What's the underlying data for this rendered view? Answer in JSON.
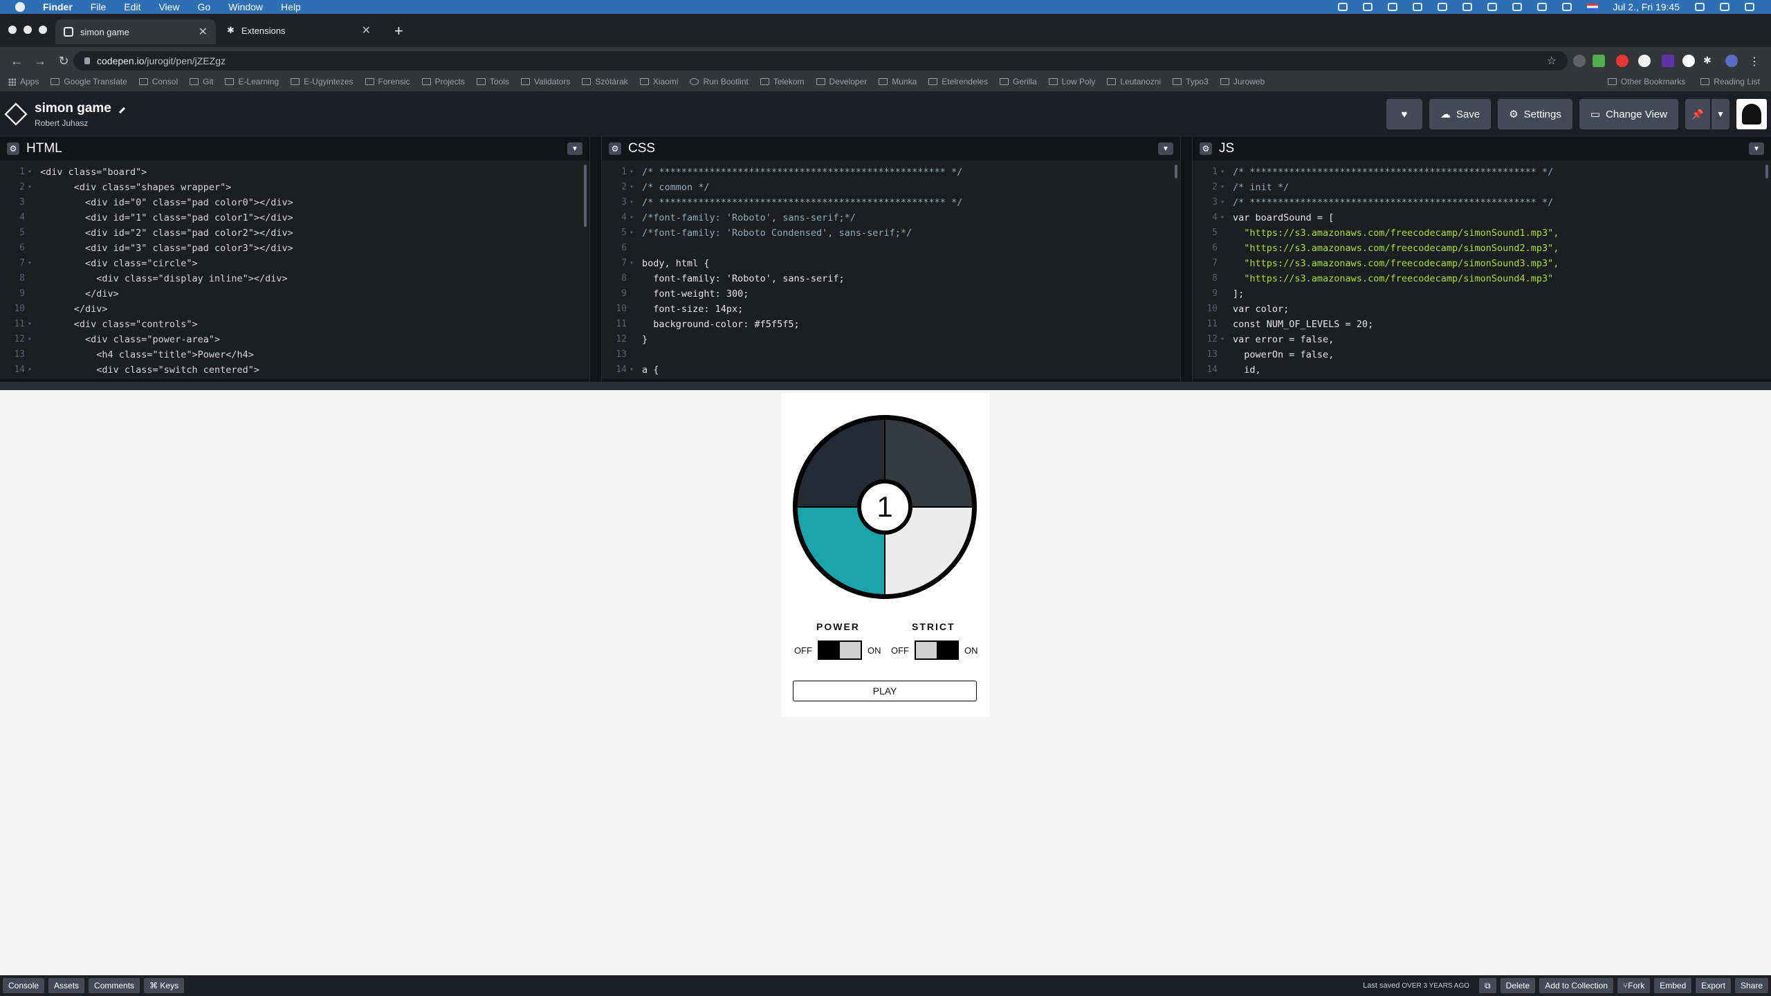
{
  "menubar": {
    "app_name": "Finder",
    "menus": [
      "File",
      "Edit",
      "View",
      "Go",
      "Window",
      "Help"
    ],
    "clock": "Jul 2., Fri 19:45"
  },
  "browser": {
    "tabs": [
      {
        "title": "simon game",
        "active": true
      },
      {
        "title": "Extensions",
        "active": false
      }
    ],
    "url_host": "codepen.io",
    "url_path": "/jurogit/pen/jZEZgz",
    "bookmarks": [
      "Apps",
      "Google Translate",
      "Consol",
      "Git",
      "E-Learning",
      "E-Ugyintezes",
      "Forensic",
      "Projects",
      "Tools",
      "Validators",
      "Szótárak",
      "Xiaomi",
      "Run Bootlint",
      "Telekom",
      "Developer",
      "Munka",
      "Etelrendeles",
      "Gerilla",
      "Low Poly",
      "Leutanozni",
      "Typo3",
      "Juroweb"
    ],
    "other_bookmarks": "Other Bookmarks",
    "reading_list": "Reading List"
  },
  "codepen": {
    "title": "simon game",
    "author": "Robert Juhasz",
    "buttons": {
      "save": "Save",
      "settings": "Settings",
      "change_view": "Change View"
    }
  },
  "editors": {
    "html": {
      "name": "HTML",
      "lines": [
        {
          "n": "1",
          "f": "▾",
          "t": "<div class=\"board\">"
        },
        {
          "n": "2",
          "f": "▾",
          "t": "      <div class=\"shapes wrapper\">"
        },
        {
          "n": "3",
          "f": "",
          "t": "        <div id=\"0\" class=\"pad color0\"></div>"
        },
        {
          "n": "4",
          "f": "",
          "t": "        <div id=\"1\" class=\"pad color1\"></div>"
        },
        {
          "n": "5",
          "f": "",
          "t": "        <div id=\"2\" class=\"pad color2\"></div>"
        },
        {
          "n": "6",
          "f": "",
          "t": "        <div id=\"3\" class=\"pad color3\"></div>"
        },
        {
          "n": "7",
          "f": "▾",
          "t": "        <div class=\"circle\">"
        },
        {
          "n": "8",
          "f": "",
          "t": "          <div class=\"display inline\"></div>"
        },
        {
          "n": "9",
          "f": "",
          "t": "        </div>"
        },
        {
          "n": "10",
          "f": "",
          "t": "      </div>"
        },
        {
          "n": "11",
          "f": "▾",
          "t": "      <div class=\"controls\">"
        },
        {
          "n": "12",
          "f": "▾",
          "t": "        <div class=\"power-area\">"
        },
        {
          "n": "13",
          "f": "",
          "t": "          <h4 class=\"title\">Power</h4>"
        },
        {
          "n": "14",
          "f": "▾",
          "t": "          <div class=\"switch centered\">"
        }
      ]
    },
    "css": {
      "name": "CSS",
      "lines": [
        {
          "n": "1",
          "f": "▾",
          "t": "/* *************************************************** */"
        },
        {
          "n": "2",
          "f": "▾",
          "t": "/* common */"
        },
        {
          "n": "3",
          "f": "▾",
          "t": "/* *************************************************** */"
        },
        {
          "n": "4",
          "f": "▾",
          "t": "/*font-family: 'Roboto', sans-serif;*/"
        },
        {
          "n": "5",
          "f": "▾",
          "t": "/*font-family: 'Roboto Condensed', sans-serif;*/"
        },
        {
          "n": "6",
          "f": "",
          "t": ""
        },
        {
          "n": "7",
          "f": "▾",
          "t": "body, html {"
        },
        {
          "n": "8",
          "f": "",
          "t": "  font-family: 'Roboto', sans-serif;"
        },
        {
          "n": "9",
          "f": "",
          "t": "  font-weight: 300;"
        },
        {
          "n": "10",
          "f": "",
          "t": "  font-size: 14px;"
        },
        {
          "n": "11",
          "f": "",
          "t": "  background-color: #f5f5f5;"
        },
        {
          "n": "12",
          "f": "",
          "t": "}"
        },
        {
          "n": "13",
          "f": "",
          "t": ""
        },
        {
          "n": "14",
          "f": "▾",
          "t": "a {"
        }
      ]
    },
    "js": {
      "name": "JS",
      "lines": [
        {
          "n": "1",
          "f": "▾",
          "t": "/* *************************************************** */"
        },
        {
          "n": "2",
          "f": "▾",
          "t": "/* init */"
        },
        {
          "n": "3",
          "f": "▾",
          "t": "/* *************************************************** */"
        },
        {
          "n": "4",
          "f": "▾",
          "t": "var boardSound = ["
        },
        {
          "n": "5",
          "f": "",
          "t": "  \"https://s3.amazonaws.com/freecodecamp/simonSound1.mp3\","
        },
        {
          "n": "6",
          "f": "",
          "t": "  \"https://s3.amazonaws.com/freecodecamp/simonSound2.mp3\","
        },
        {
          "n": "7",
          "f": "",
          "t": "  \"https://s3.amazonaws.com/freecodecamp/simonSound3.mp3\","
        },
        {
          "n": "8",
          "f": "",
          "t": "  \"https://s3.amazonaws.com/freecodecamp/simonSound4.mp3\""
        },
        {
          "n": "9",
          "f": "",
          "t": "];"
        },
        {
          "n": "10",
          "f": "",
          "t": "var color;"
        },
        {
          "n": "11",
          "f": "",
          "t": "const NUM_OF_LEVELS = 20;"
        },
        {
          "n": "12",
          "f": "▾",
          "t": "var error = false,"
        },
        {
          "n": "13",
          "f": "",
          "t": "  powerOn = false,"
        },
        {
          "n": "14",
          "f": "",
          "t": "  id,"
        }
      ]
    }
  },
  "preview": {
    "display": "1",
    "power_label": "POWER",
    "strict_label": "STRICT",
    "off_label": "OFF",
    "on_label": "ON",
    "play_label": "PLAY"
  },
  "bottombar": {
    "left_buttons": [
      "Console",
      "Assets",
      "Comments",
      "⌘ Keys"
    ],
    "saved_prefix": "Last saved",
    "saved_when": "over 3 years ago",
    "right_buttons": [
      "Delete",
      "Add to Collection",
      "Fork",
      "Embed",
      "Export",
      "Share"
    ]
  }
}
